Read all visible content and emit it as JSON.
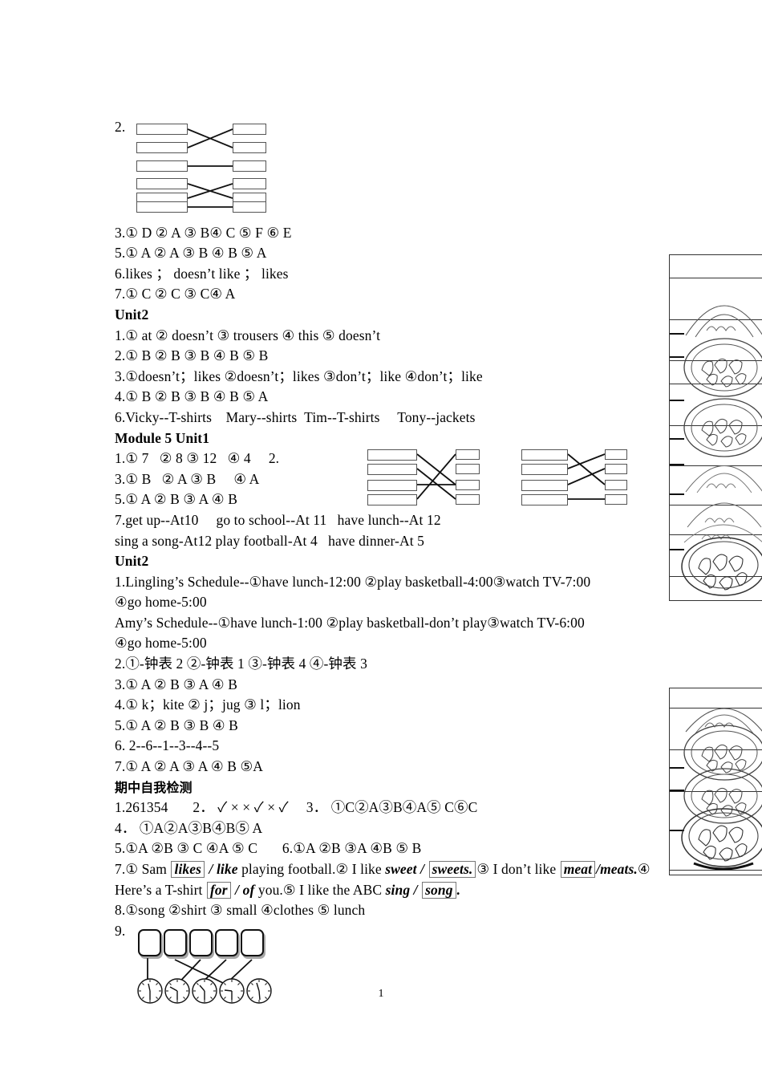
{
  "page": {
    "number": "1"
  },
  "answer_key": {
    "lines": [
      {
        "id": "l-2-label",
        "text": "2."
      },
      {
        "id": "l-3",
        "text": "3.① D ② A ③ B④ C ⑤ F ⑥ E"
      },
      {
        "id": "l-5",
        "text": "5.① A ② A ③ B ④ B ⑤ A"
      },
      {
        "id": "l-6",
        "text": "6.likes ； doesn’t like ； likes"
      },
      {
        "id": "l-7",
        "text": "7.① C ② C ③ C④ A"
      },
      {
        "id": "h-unit2-a",
        "text": "Unit2"
      },
      {
        "id": "u2-1",
        "text": "1.① at ② doesn’t ③ trousers ④ this ⑤ doesn’t"
      },
      {
        "id": "u2-2",
        "text": "2.① B ② B ③ B ④ B ⑤ B"
      },
      {
        "id": "u2-3",
        "text": "3.①doesn’t；likes ②doesn’t；likes ③don’t；like ④don’t；like"
      },
      {
        "id": "u2-4",
        "text": "4.① B ② B ③ B ④ B ⑤ A"
      },
      {
        "id": "u2-6",
        "text": "6.Vicky--T-shirts Mary--shirts Tim--T-shirts  Tony--jackets"
      },
      {
        "id": "h-m5u1",
        "text": "Module 5  Unit1"
      },
      {
        "id": "m5-1",
        "text": "1.① 7  ② 8 ③ 12  ④ 4  2."
      },
      {
        "id": "m5-3",
        "text": "3.① B  ② A ③ B  ④ A"
      },
      {
        "id": "m5-5",
        "text": "5.① A ② B ③ A ④ B"
      },
      {
        "id": "m5-7a",
        "text": "7.get up--At10  go to school--At 11  have lunch--At 12"
      },
      {
        "id": "m5-7b",
        "text": " sing a song-At12  play football-At 4  have dinner-At 5"
      },
      {
        "id": "h-unit2-b",
        "text": "Unit2"
      },
      {
        "id": "m5u2-1a",
        "text": "1.Lingling’s Schedule--①have lunch-12:00 ②play basketball-4:00③watch TV-7:00"
      },
      {
        "id": "m5u2-1b",
        "text": "④go home-5:00"
      },
      {
        "id": "m5u2-1c",
        "text": " Amy’s Schedule--①have lunch-1:00 ②play basketball-don’t play③watch TV-6:00"
      },
      {
        "id": "m5u2-1d",
        "text": "④go home-5:00"
      },
      {
        "id": "m5u2-2",
        "text": "2.①-钟表 2 ②-钟表 1 ③-钟表 4 ④-钟表 3"
      },
      {
        "id": "m5u2-3",
        "text": "3.① A ② B ③ A ④ B"
      },
      {
        "id": "m5u2-4",
        "text": "4.① k；kite ② j；jug ③ l；lion"
      },
      {
        "id": "m5u2-5",
        "text": "5.① A ② B ③ B ④ B"
      },
      {
        "id": "m5u2-6",
        "text": "6. 2--6--1--3--4--5"
      },
      {
        "id": "m5u2-7",
        "text": "7.① A ② A ③ A ④ B ⑤A"
      },
      {
        "id": "h-midterm",
        "text": "期中自我检测"
      },
      {
        "id": "mt-1",
        "text": "1.261354   2． ✓ × × ✓ × ✓  3． ①C②A③B④A⑤ C⑥C"
      },
      {
        "id": "mt-4",
        "text": "4． ①A②A③B④B⑤ A"
      },
      {
        "id": "mt-5",
        "text": "5.①A ②B ③ C ④A ⑤ C   6.①A ②B ③A ④B ⑤ B"
      },
      {
        "id": "mt-8",
        "text": "8.①song ②shirt ③ small ④clothes ⑤ lunch"
      },
      {
        "id": "mt-9-label",
        "text": "9."
      }
    ],
    "item7": {
      "prefix": "7.① Sam ",
      "seg1_box": "likes",
      "seg1_rest": " / like",
      "seg2": " playing football.② I like ",
      "seg3_ital": "sweet",
      "seg3_sep": " / ",
      "seg3_box": "sweets.",
      "seg4": "③ I don’t like ",
      "seg5_box": "meat",
      "line2_box": "/meats.",
      "seg6": "④ Here’s a T-shirt ",
      "seg7_box": "for",
      "seg7_rest": " / of",
      "seg8": " you.⑤ I like the ABC ",
      "seg9_ital": "sing",
      "seg9_sep": " / ",
      "seg9_box": "song",
      "seg9_end": "."
    }
  },
  "diagrams": {
    "match_top": {
      "name": "matching-diagram-exercise-2",
      "rows": 6,
      "links": "1-2 crossed, 3 straight, 4-5 crossed, 6 straight"
    },
    "match_mid_left": {
      "name": "matching-diagram-module5-a",
      "rows": 4,
      "links": "crossed"
    },
    "match_mid_right": {
      "name": "matching-diagram-module5-b",
      "rows": 4,
      "links": "crossed"
    },
    "item9": {
      "name": "word-clock-matching",
      "boxes": 5,
      "clocks": 5,
      "clock_times": [
        "6:30",
        "7:00",
        "4:30",
        "3:00",
        "6:00"
      ]
    }
  },
  "scan_artifacts": [
    {
      "name": "scanned-bowl-strip-upper"
    },
    {
      "name": "scanned-bowl-strip-lower"
    }
  ]
}
